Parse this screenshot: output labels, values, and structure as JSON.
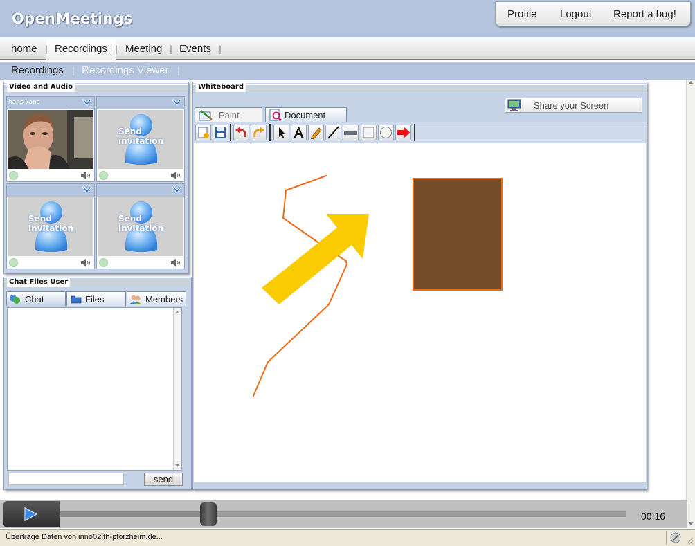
{
  "header": {
    "logo": "OpenMeetings"
  },
  "top_links": [
    "Profile",
    "Logout",
    "Report a bug!"
  ],
  "nav": {
    "items": [
      "home",
      "Recordings",
      "Meeting",
      "Events"
    ],
    "active": "Recordings",
    "separator": "|"
  },
  "sub_nav": {
    "items": [
      "Recordings",
      "Recordings Viewer"
    ],
    "separator": "|"
  },
  "video_panel": {
    "title": "Video and Audio",
    "tiles": [
      {
        "name": "hans kans",
        "invite": ""
      },
      {
        "name": "",
        "invite": "Send\ninvitation"
      },
      {
        "name": "",
        "invite": "Send\ninvitation"
      },
      {
        "name": "",
        "invite": "Send\ninvitation"
      }
    ]
  },
  "chat_panel": {
    "title": "Chat Files User",
    "tabs": [
      "Chat",
      "Files",
      "Members"
    ],
    "input_value": "",
    "send_label": "send"
  },
  "whiteboard": {
    "title": "Whiteboard",
    "tabs": [
      "Paint",
      "Document"
    ],
    "share_label": "Share your Screen"
  },
  "player": {
    "time": "00:16",
    "progress": 0.263
  },
  "status_bar": {
    "text": "Übertrage Daten von inno02.fh-pforzheim.de..."
  },
  "colors": {
    "header_blue": "#b3c4dc",
    "panel_blue": "#c6d3e6",
    "shape_brown": "#744c28",
    "arrow_yellow": "#f9cb00",
    "stroke_orange": "#f06a14"
  }
}
